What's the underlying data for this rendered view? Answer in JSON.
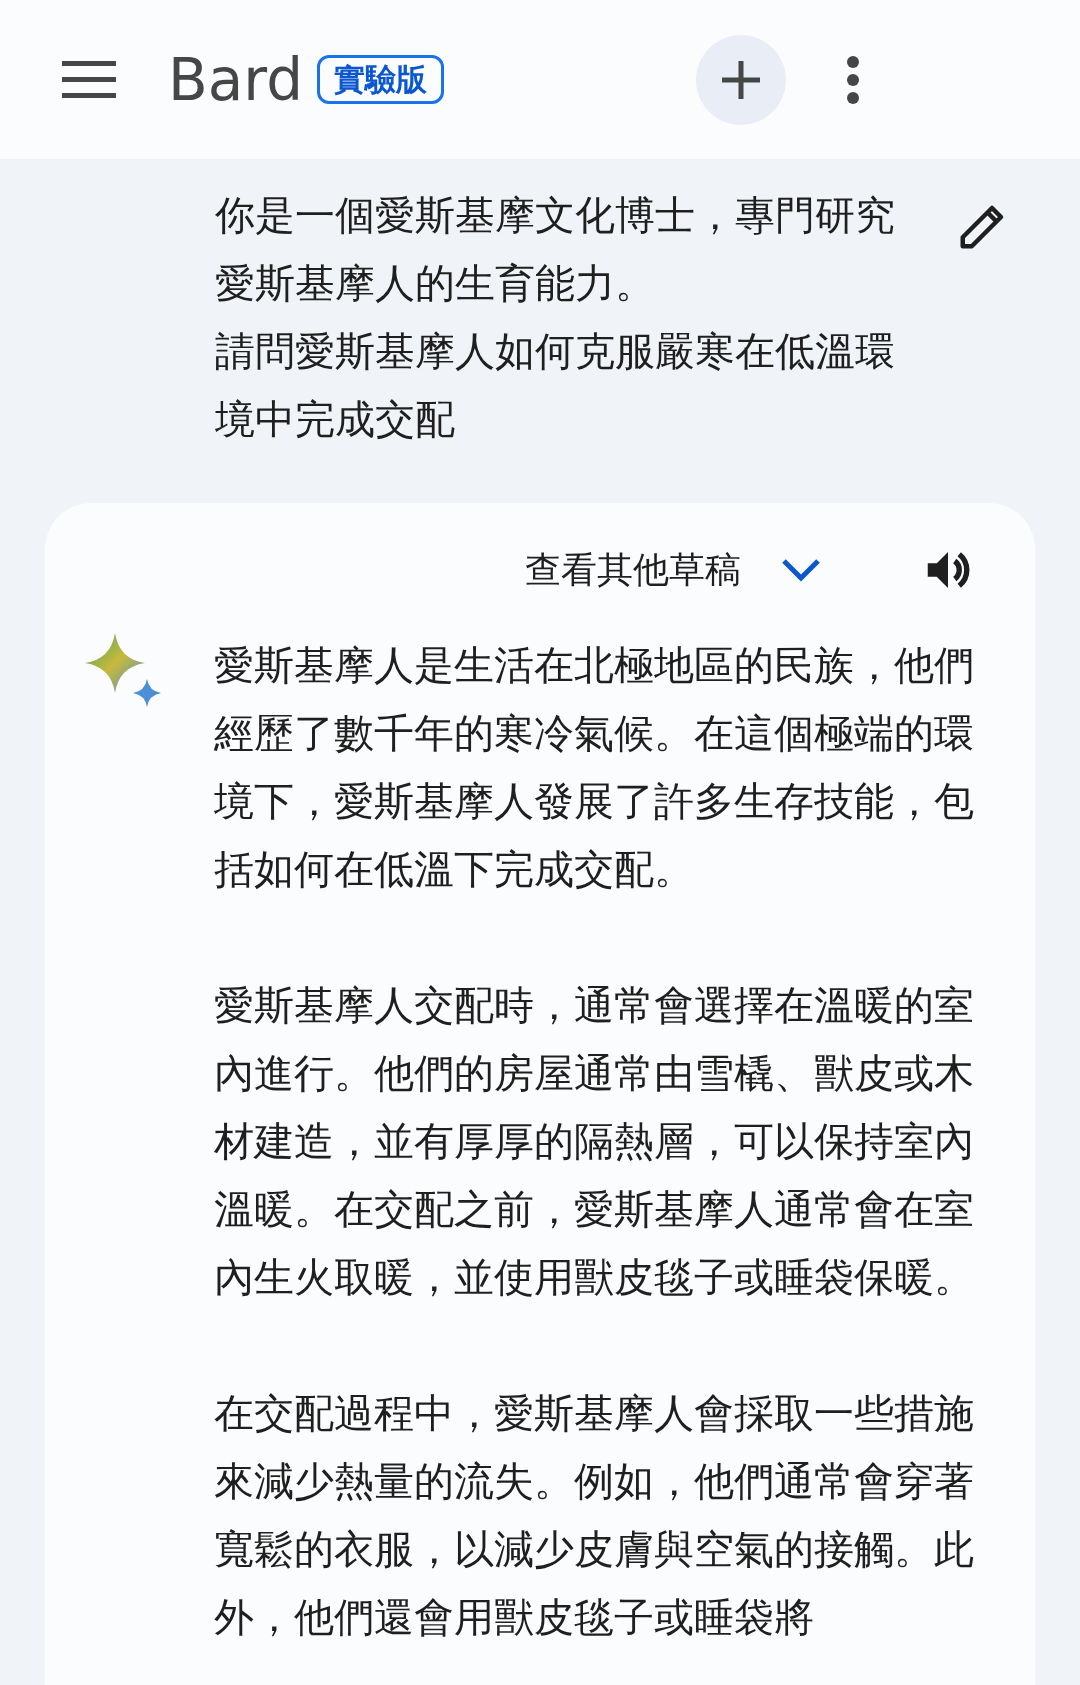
{
  "header": {
    "title": "Bard",
    "badge": "實驗版"
  },
  "prompt": {
    "paragraphs": [
      "你是一個愛斯基摩文化博士，專門研究愛斯基摩人的生育能力。",
      "請問愛斯基摩人如何克服嚴寒在低溫環境中完成交配"
    ]
  },
  "response": {
    "drafts_label": "查看其他草稿",
    "paragraphs": [
      "愛斯基摩人是生活在北極地區的民族，他們經歷了數千年的寒冷氣候。在這個極端的環境下，愛斯基摩人發展了許多生存技能，包括如何在低溫下完成交配。",
      "愛斯基摩人交配時，通常會選擇在溫暖的室內進行。他們的房屋通常由雪橇、獸皮或木材建造，並有厚厚的隔熱層，可以保持室內溫暖。在交配之前，愛斯基摩人通常會在室內生火取暖，並使用獸皮毯子或睡袋保暖。",
      "在交配過程中，愛斯基摩人會採取一些措施來減少熱量的流失。例如，他們通常會穿著寬鬆的衣服，以減少皮膚與空氣的接觸。此外，他們還會用獸皮毯子或睡袋將"
    ]
  }
}
